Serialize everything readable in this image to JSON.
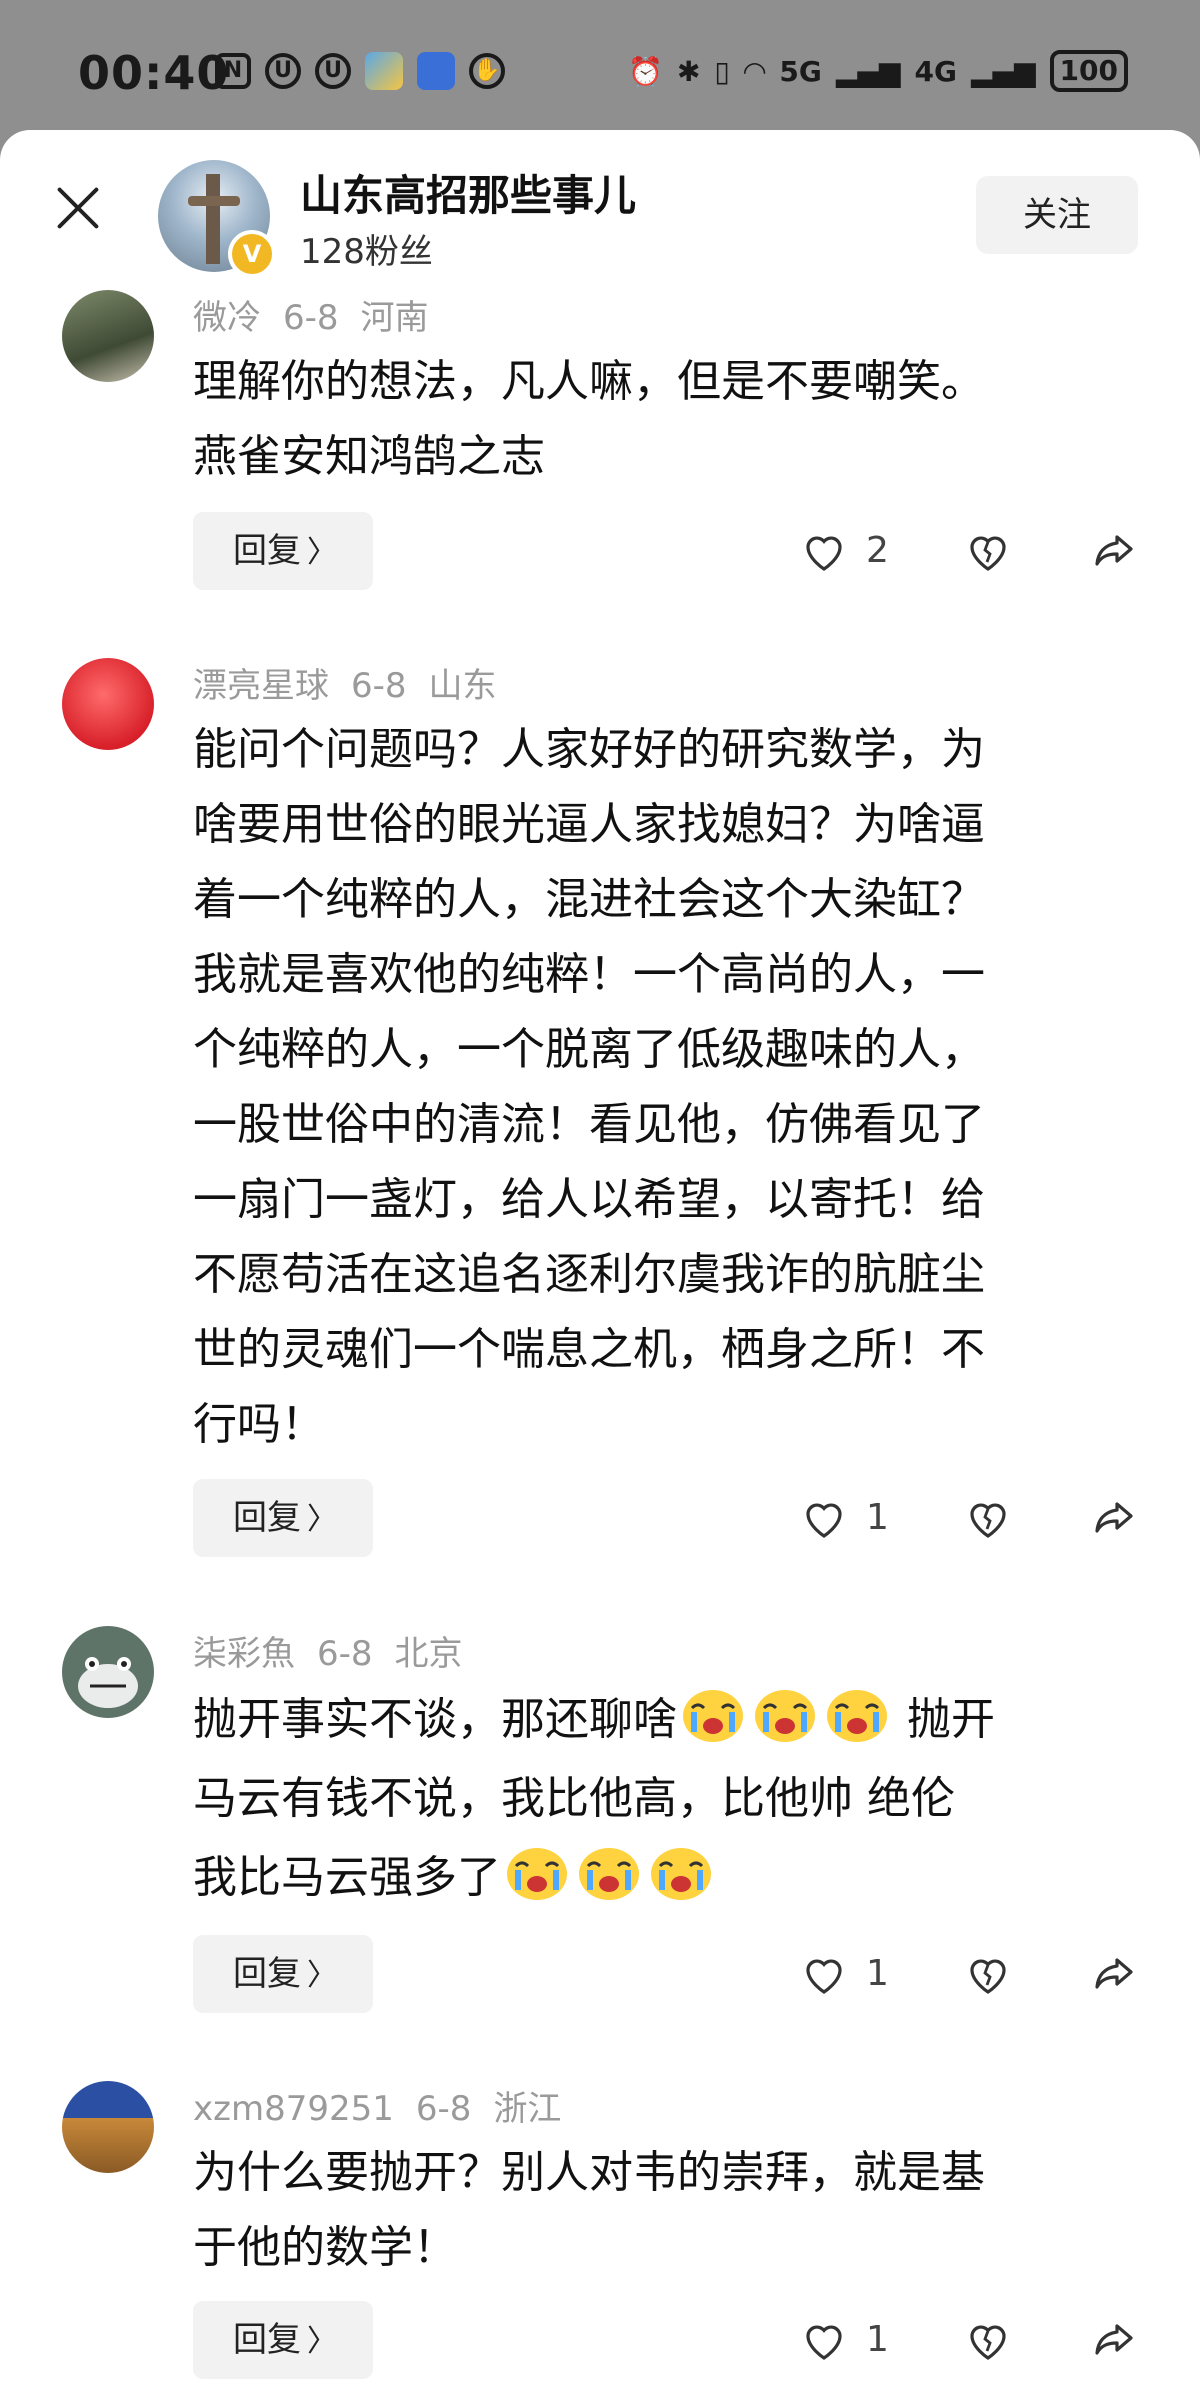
{
  "status_bar": {
    "time": "00:40",
    "network1": "5G",
    "network2": "4G",
    "battery": "100"
  },
  "header": {
    "author_name": "山东高招那些事儿",
    "fans": "128粉丝",
    "follow_label": "关注",
    "verified_badge": "V"
  },
  "comments": [
    {
      "user": "微冷",
      "date": "6-8",
      "location": "河南",
      "lines": [
        "理解你的想法，凡人嘛，但是不要嘲笑。",
        "燕雀安知鸿鹄之志"
      ],
      "reply_label": "回复",
      "likes": "2"
    },
    {
      "user": "漂亮星球",
      "date": "6-8",
      "location": "山东",
      "lines": [
        "能问个问题吗？人家好好的研究数学，为",
        "啥要用世俗的眼光逼人家找媳妇？为啥逼",
        "着一个纯粹的人，混进社会这个大染缸？",
        "我就是喜欢他的纯粹！一个高尚的人，一",
        "个纯粹的人，一个脱离了低级趣味的人，",
        "一股世俗中的清流！看见他，仿佛看见了",
        "一扇门一盏灯，给人以希望，以寄托！给",
        "不愿苟活在这追名逐利尔虞我诈的肮脏尘",
        "世的灵魂们一个喘息之机，栖身之所！不",
        "行吗！"
      ],
      "reply_label": "回复",
      "likes": "1"
    },
    {
      "user": "柒彩魚",
      "date": "6-8",
      "location": "北京",
      "line1_a": "抛开事实不谈，那还聊啥",
      "line1_b": " 抛开",
      "line2": "马云有钱不说，我比他高，比他帅 绝伦",
      "line3": "我比马云强多了",
      "reply_label": "回复",
      "likes": "1"
    },
    {
      "user": "xzm879251",
      "date": "6-8",
      "location": "浙江",
      "lines": [
        "为什么要抛开？别人对韦的崇拜，就是基",
        "于他的数学！"
      ],
      "reply_label": "回复",
      "likes": "1"
    }
  ]
}
